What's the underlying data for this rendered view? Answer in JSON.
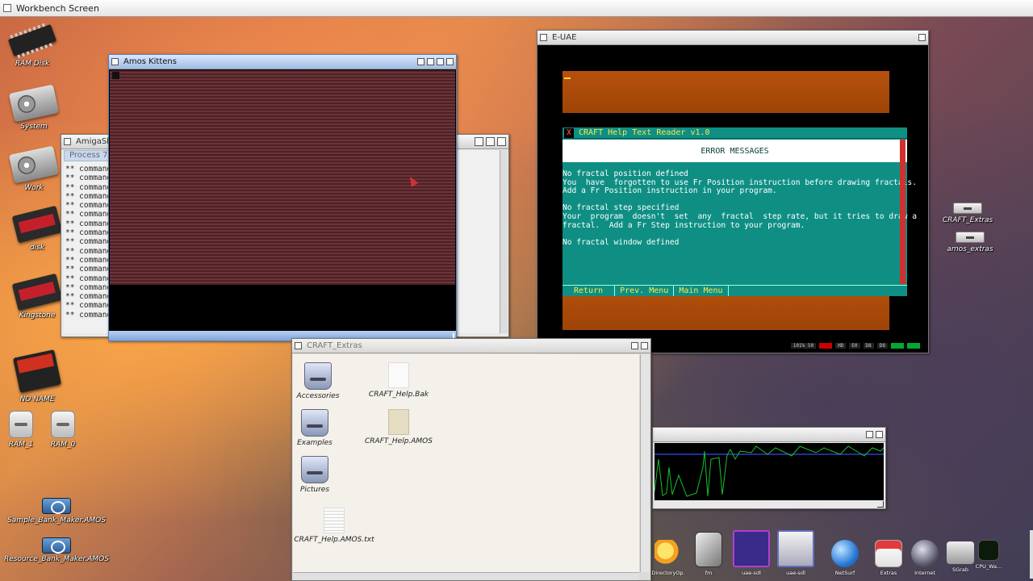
{
  "screen": {
    "title": "Workbench Screen"
  },
  "desktop_icons": [
    {
      "label": "RAM Disk",
      "icon": "ram-chip-icon"
    },
    {
      "label": "System",
      "icon": "harddisk-icon"
    },
    {
      "label": "Work",
      "icon": "harddisk-icon"
    },
    {
      "label": "disk",
      "icon": "ssd-icon"
    },
    {
      "label": "Kingstone",
      "icon": "ssd-icon"
    },
    {
      "label": "NO NAME",
      "icon": "sdcard-icon"
    },
    {
      "label": "RAM_1",
      "icon": "ram-drive-icon"
    },
    {
      "label": "RAM_0",
      "icon": "ram-drive-icon"
    },
    {
      "label": "Sample_Bank_Maker.AMOS",
      "icon": "amos-program-icon"
    },
    {
      "label": "Resource_Bank_Maker.AMOS",
      "icon": "amos-program-icon"
    },
    {
      "label": "CRAFT_Extras",
      "icon": "drawer-icon"
    },
    {
      "label": "amos_extras",
      "icon": "drawer-icon"
    }
  ],
  "shell_window": {
    "title": "AmigaSh",
    "tab": "Process 7",
    "lines": [
      "** commands",
      "** commands",
      "** commands",
      "** commands",
      "** commands",
      "** commands",
      "** commands",
      "** commands",
      "** commands",
      "** commands",
      "** commands",
      "** commands",
      "** commands",
      "** commands",
      "** commands",
      "** commands",
      "** commands"
    ]
  },
  "kitten_window": {
    "title": "Amos Kittens"
  },
  "euae_window": {
    "title": "E-UAE",
    "craft": {
      "title": "CRAFT Help Text Reader v1.0",
      "close_glyph": "X",
      "header": "ERROR MESSAGES",
      "text": "No fractal position defined\nYou  have  forgotten to use Fr Position instruction before drawing fractals.\nAdd a Fr Position instruction in your program.\n\nNo fractal step specified\nYour  program  doesn't  set  any  fractal  step rate, but it tries to draw a\nfractal.  Add a Fr Step instruction to your program.\n\nNo fractal window defined",
      "buttons": [
        "Return",
        "Prev. Menu",
        "Main Menu"
      ]
    },
    "status": [
      "101% 50",
      "",
      "HD",
      "E0",
      "D8",
      "D8",
      "",
      ""
    ]
  },
  "drawer_window": {
    "title": "CRAFT_Extras",
    "files": [
      {
        "label": "Accessories",
        "icon": "drawer-icon"
      },
      {
        "label": "CRAFT_Help.Bak",
        "icon": "document-icon"
      },
      {
        "label": "Examples",
        "icon": "drawer-icon"
      },
      {
        "label": "CRAFT_Help.AMOS",
        "icon": "amos-document-icon"
      },
      {
        "label": "Pictures",
        "icon": "drawer-icon"
      },
      {
        "label": "CRAFT_Help.AMOS.txt",
        "icon": "text-document-icon"
      }
    ]
  },
  "dock": {
    "items": [
      {
        "label": "DirectoryOp.",
        "icon": "sun-tools-icon"
      },
      {
        "label": "fm",
        "icon": "filemanager-icon"
      },
      {
        "label": "uae-sdl",
        "icon": "floppy-icon"
      },
      {
        "label": "uae-sdl",
        "icon": "floppy-doc-icon"
      },
      {
        "label": "NetSurf",
        "icon": "globe-icon"
      },
      {
        "label": "Extras",
        "icon": "extras-icon"
      },
      {
        "label": "Internet",
        "icon": "internet-icon"
      },
      {
        "label": "SGrab",
        "icon": "camera-icon"
      },
      {
        "label": "CPU_Wa...",
        "icon": "cpu-monitor-icon"
      }
    ]
  },
  "colors": {
    "craft_bg": "#0f8f84",
    "craft_title": "#ffe54a",
    "uae_orange": "#b7510c",
    "kitten_stripe": "#6d3238"
  }
}
